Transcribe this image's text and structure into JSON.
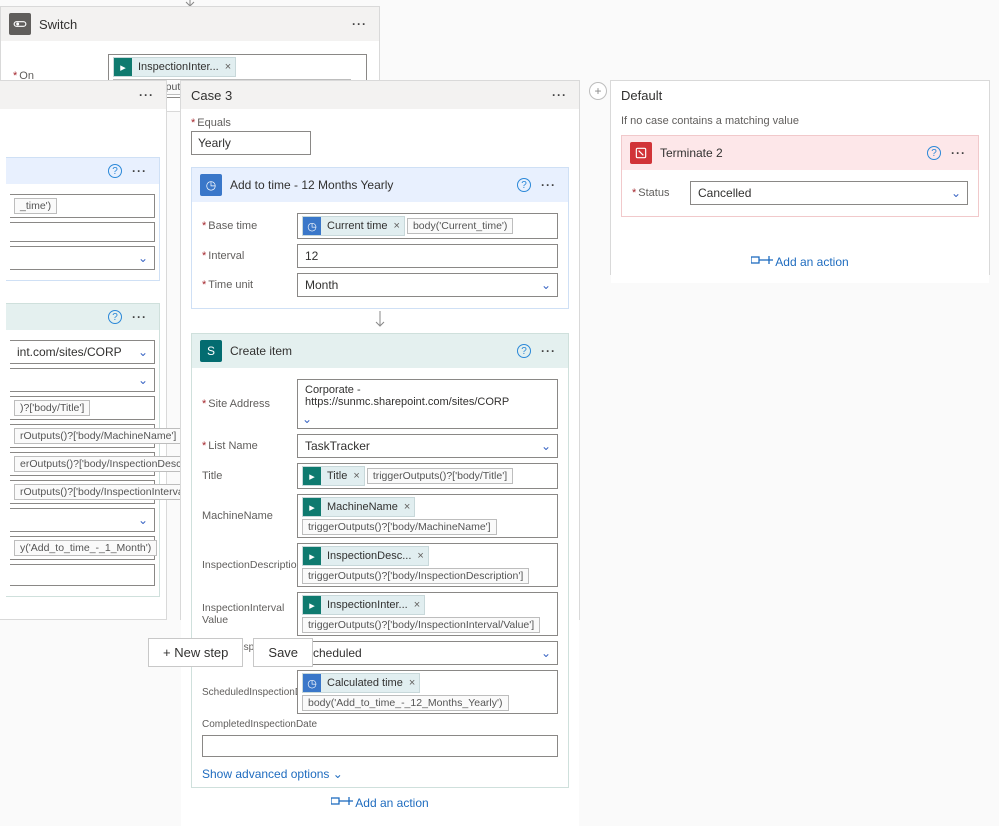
{
  "switch": {
    "title": "Switch",
    "on_label": "On",
    "pill_label": "InspectionInter...",
    "pill_icon": "dynamic",
    "expr": "triggerOutputs()?['body/InspectionInterval/Value']"
  },
  "left_case": {
    "field_site_value": "int.com/sites/CORP",
    "pillTitle": "_time')",
    "exprs": [
      ")?['body/Title']",
      "rOutputs()?['body/MachineName']",
      "erOutputs()?['body/InspectionDescription']",
      "rOutputs()?['body/InspectionInterval/Value']",
      "y('Add_to_time_-_1_Month')"
    ]
  },
  "case3": {
    "title": "Case 3",
    "equals_label": "Equals",
    "equals_value": "Yearly",
    "addtime": {
      "title": "Add to time - 12 Months Yearly",
      "base_time_label": "Base time",
      "base_pill": "Current time",
      "base_expr": "body('Current_time')",
      "interval_label": "Interval",
      "interval_value": "12",
      "unit_label": "Time unit",
      "unit_value": "Month"
    },
    "create": {
      "title": "Create item",
      "site_label": "Site Address",
      "site_value": "Corporate - https://sunmc.sharepoint.com/sites/CORP",
      "list_label": "List Name",
      "list_value": "TaskTracker",
      "title_label": "Title",
      "title_pill": "Title",
      "title_expr": "triggerOutputs()?['body/Title']",
      "machine_label": "MachineName",
      "machine_pill": "MachineName",
      "machine_expr": "triggerOutputs()?['body/MachineName']",
      "desc_label": "InspectionDescription",
      "desc_pill": "InspectionDesc...",
      "desc_expr": "triggerOutputs()?['body/InspectionDescription']",
      "intval_label": "InspectionInterval Value",
      "intval_pill": "InspectionInter...",
      "intval_expr": "triggerOutputs()?['body/InspectionInterval/Value']",
      "status_label": "CurrentInspectionStatus Value",
      "status_value": "Scheduled",
      "sched_label": "ScheduledInspectionDate",
      "sched_pill": "Calculated time",
      "sched_expr": "body('Add_to_time_-_12_Months_Yearly')",
      "completed_label": "CompletedInspectionDate",
      "advanced": "Show advanced options"
    },
    "add_action": "Add an action"
  },
  "default": {
    "title": "Default",
    "subtitle": "If no case contains a matching value",
    "terminate": {
      "title": "Terminate 2",
      "status_label": "Status",
      "status_value": "Cancelled"
    },
    "add_action": "Add an action"
  },
  "footer": {
    "new_step": "+ New step",
    "save": "Save"
  }
}
